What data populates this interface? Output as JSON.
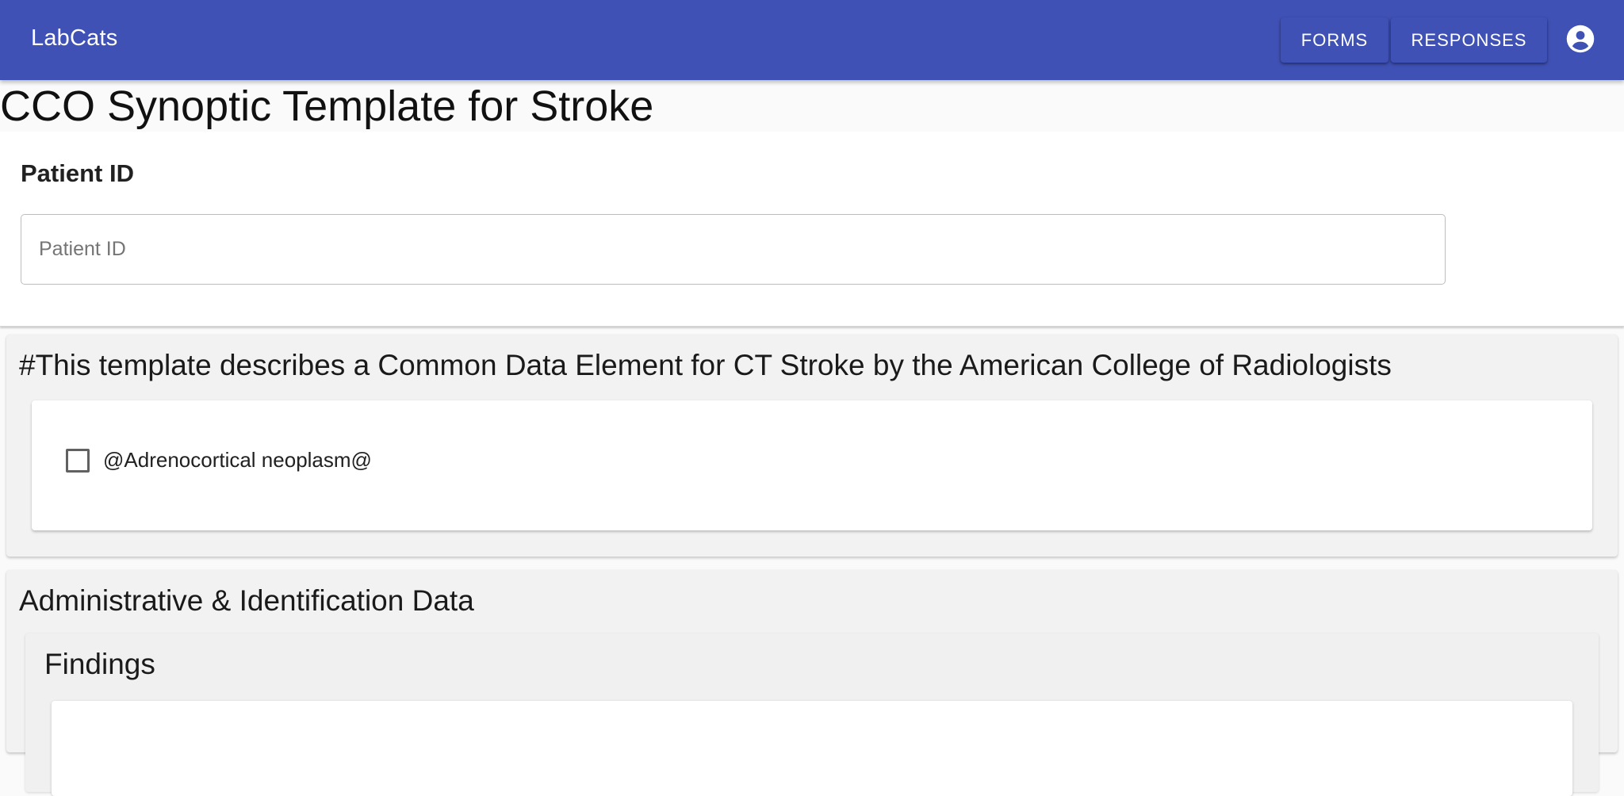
{
  "app": {
    "brand": "LabCats",
    "nav": {
      "forms_label": "FORMS",
      "responses_label": "RESPONSES"
    },
    "account_icon": "account-circle-icon",
    "accent_color": "#3f51b5"
  },
  "form": {
    "title": "CCO Synoptic Template for Stroke",
    "patient_id": {
      "label": "Patient ID",
      "placeholder": "Patient ID",
      "value": ""
    },
    "sections": [
      {
        "heading": "#This template describes a Common Data Element for CT Stroke by the American College of Radiologists",
        "items": [
          {
            "label": "@Adrenocortical neoplasm@",
            "checked": false
          }
        ]
      },
      {
        "heading": "Administrative & Identification Data",
        "subsections": [
          {
            "heading": "Findings"
          }
        ]
      }
    ]
  }
}
